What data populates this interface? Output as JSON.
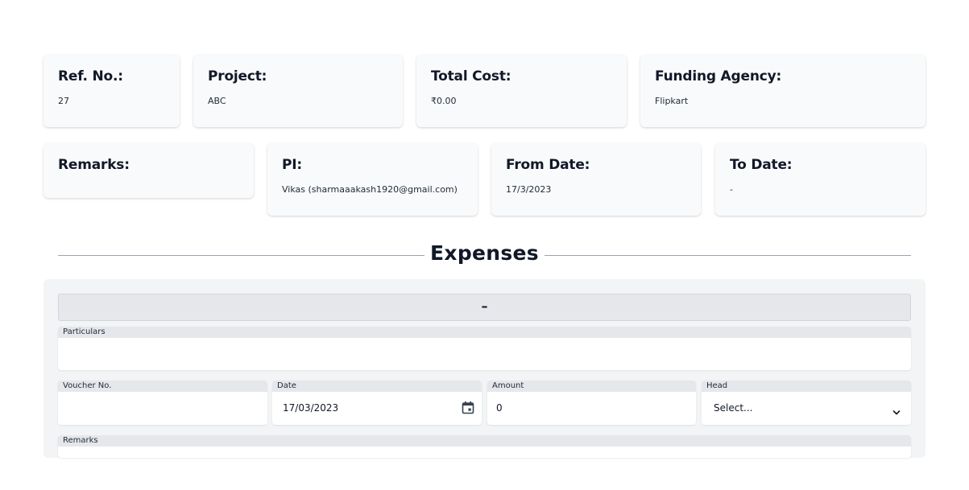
{
  "info_row1": [
    {
      "label": "Ref. No.:",
      "value": "27"
    },
    {
      "label": "Project:",
      "value": "ABC"
    },
    {
      "label": "Total Cost:",
      "value": "₹0.00"
    },
    {
      "label": "Funding Agency:",
      "value": "Flipkart"
    }
  ],
  "info_row2": [
    {
      "label": "Remarks:",
      "value": ""
    },
    {
      "label": "PI:",
      "value": "Vikas (sharmaaakash1920@gmail.com)"
    },
    {
      "label": "From Date:",
      "value": "17/3/2023"
    },
    {
      "label": "To Date:",
      "value": "-"
    }
  ],
  "expenses": {
    "title": "Expenses",
    "collapse_label": "–",
    "fields": {
      "particulars": {
        "label": "Particulars",
        "value": ""
      },
      "voucher_no": {
        "label": "Voucher No.",
        "value": ""
      },
      "date": {
        "label": "Date",
        "value": "17/03/2023"
      },
      "amount": {
        "label": "Amount",
        "value": "0"
      },
      "head": {
        "label": "Head",
        "value": "Select..."
      },
      "remarks": {
        "label": "Remarks",
        "value": ""
      }
    }
  },
  "icons": {
    "date_picker": "calendar-icon",
    "head_select": "chevron-down-icon"
  }
}
